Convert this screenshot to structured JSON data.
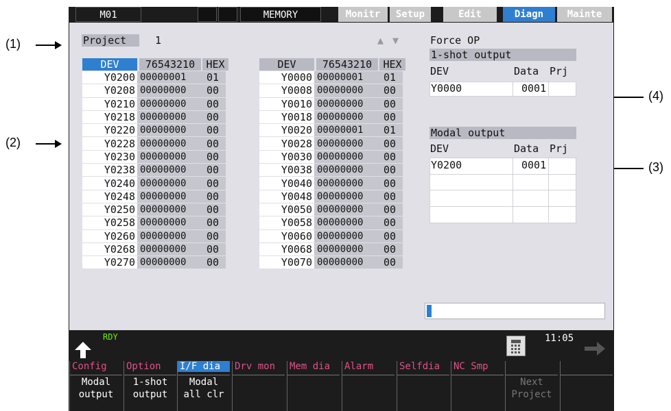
{
  "topbar": {
    "device": "M01",
    "operation_mode": "MEMORY",
    "modes": [
      "Monitr",
      "Setup",
      "Edit",
      "Diagn",
      "Mainte"
    ],
    "active_mode": "Diagn"
  },
  "project": {
    "label": "Project",
    "value": "1"
  },
  "table_headers": {
    "dev": "DEV",
    "bits": "76543210",
    "hex": "HEX"
  },
  "left_table": [
    {
      "dev": "Y0200",
      "bits": "00000001",
      "hex": "01"
    },
    {
      "dev": "Y0208",
      "bits": "00000000",
      "hex": "00"
    },
    {
      "dev": "Y0210",
      "bits": "00000000",
      "hex": "00"
    },
    {
      "dev": "Y0218",
      "bits": "00000000",
      "hex": "00"
    },
    {
      "dev": "Y0220",
      "bits": "00000000",
      "hex": "00"
    },
    {
      "dev": "Y0228",
      "bits": "00000000",
      "hex": "00"
    },
    {
      "dev": "Y0230",
      "bits": "00000000",
      "hex": "00"
    },
    {
      "dev": "Y0238",
      "bits": "00000000",
      "hex": "00"
    },
    {
      "dev": "Y0240",
      "bits": "00000000",
      "hex": "00"
    },
    {
      "dev": "Y0248",
      "bits": "00000000",
      "hex": "00"
    },
    {
      "dev": "Y0250",
      "bits": "00000000",
      "hex": "00"
    },
    {
      "dev": "Y0258",
      "bits": "00000000",
      "hex": "00"
    },
    {
      "dev": "Y0260",
      "bits": "00000000",
      "hex": "00"
    },
    {
      "dev": "Y0268",
      "bits": "00000000",
      "hex": "00"
    },
    {
      "dev": "Y0270",
      "bits": "00000000",
      "hex": "00"
    }
  ],
  "right_table": [
    {
      "dev": "Y0000",
      "bits": "00000001",
      "hex": "01"
    },
    {
      "dev": "Y0008",
      "bits": "00000000",
      "hex": "00"
    },
    {
      "dev": "Y0010",
      "bits": "00000000",
      "hex": "00"
    },
    {
      "dev": "Y0018",
      "bits": "00000000",
      "hex": "00"
    },
    {
      "dev": "Y0020",
      "bits": "00000001",
      "hex": "01"
    },
    {
      "dev": "Y0028",
      "bits": "00000000",
      "hex": "00"
    },
    {
      "dev": "Y0030",
      "bits": "00000000",
      "hex": "00"
    },
    {
      "dev": "Y0038",
      "bits": "00000000",
      "hex": "00"
    },
    {
      "dev": "Y0040",
      "bits": "00000000",
      "hex": "00"
    },
    {
      "dev": "Y0048",
      "bits": "00000000",
      "hex": "00"
    },
    {
      "dev": "Y0050",
      "bits": "00000000",
      "hex": "00"
    },
    {
      "dev": "Y0058",
      "bits": "00000000",
      "hex": "00"
    },
    {
      "dev": "Y0060",
      "bits": "00000000",
      "hex": "00"
    },
    {
      "dev": "Y0068",
      "bits": "00000000",
      "hex": "00"
    },
    {
      "dev": "Y0070",
      "bits": "00000000",
      "hex": "00"
    }
  ],
  "force_op": {
    "title": "Force OP",
    "oneshot_title": "1-shot output",
    "modal_title": "Modal output",
    "col_dev": "DEV",
    "col_data": "Data",
    "col_prj": "Prj",
    "oneshot_row": {
      "dev": "Y0000",
      "data": "0001",
      "prj": ""
    },
    "modal_row": {
      "dev": "Y0200",
      "data": "0001",
      "prj": ""
    }
  },
  "callouts": [
    "(1)",
    "(2)",
    "(3)",
    "(4)"
  ],
  "status": {
    "ready": "RDY",
    "time": "11:05"
  },
  "icons": [
    "back-arrow-icon",
    "calculator-icon",
    "forward-arrow-icon",
    "up-triangle-icon",
    "down-triangle-icon"
  ],
  "softkeys": [
    {
      "top": "Config",
      "sub1": "Modal",
      "sub2": "output"
    },
    {
      "top": "Option",
      "sub1": "1-shot",
      "sub2": "output"
    },
    {
      "top": "I/F dia",
      "sub1": "Modal",
      "sub2": "all clr"
    },
    {
      "top": "Drv mon",
      "sub1": "",
      "sub2": ""
    },
    {
      "top": "Mem dia",
      "sub1": "",
      "sub2": ""
    },
    {
      "top": "Alarm",
      "sub1": "",
      "sub2": ""
    },
    {
      "top": "Selfdia",
      "sub1": "",
      "sub2": ""
    },
    {
      "top": "NC Smp",
      "sub1": "",
      "sub2": ""
    },
    {
      "top": "",
      "sub1": "Next",
      "sub2": "Project"
    },
    {
      "top": "",
      "sub1": "",
      "sub2": ""
    }
  ],
  "colors": {
    "accent": "#2f7fd0",
    "menu_text": "#e0508a",
    "ready": "#6cf000",
    "panel": "#e0e0e6"
  }
}
